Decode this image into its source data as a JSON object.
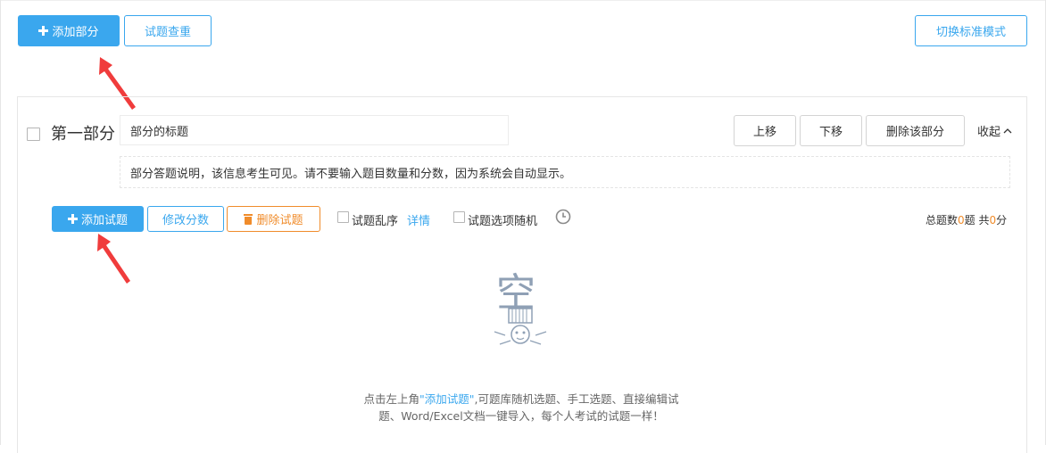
{
  "toolbar": {
    "add_section_label": "添加部分",
    "duplicate_check_label": "试题查重",
    "switch_mode_label": "切换标准模式"
  },
  "section": {
    "name": "第一部分",
    "title_value": "部分的标题",
    "description_value": "部分答题说明，该信息考生可见。请不要输入题目数量和分数，因为系统会自动显示。",
    "move_up_label": "上移",
    "move_down_label": "下移",
    "delete_label": "删除该部分",
    "collapse_label": "收起"
  },
  "questions_bar": {
    "add_question_label": "添加试题",
    "edit_score_label": "修改分数",
    "delete_question_label": "删除试题",
    "shuffle_label": "试题乱序",
    "details_link": "详情",
    "random_options_label": "试题选项随机",
    "total_prefix": "总题数",
    "total_count": "0",
    "total_unit": "题 共",
    "total_score": "0",
    "score_unit": "分"
  },
  "empty_state": {
    "illustration_label": "空",
    "line1_prefix": "点击左上角",
    "line1_link": "\"添加试题\"",
    "line1_suffix": ",可题库随机选题、手工选题、直接编辑试",
    "line2": "题、Word/Excel文档一键导入，每个人考试的试题一样！"
  },
  "colors": {
    "accent": "#3aa7ee",
    "warning": "#f08c2b",
    "annotation": "#f03c3c"
  }
}
